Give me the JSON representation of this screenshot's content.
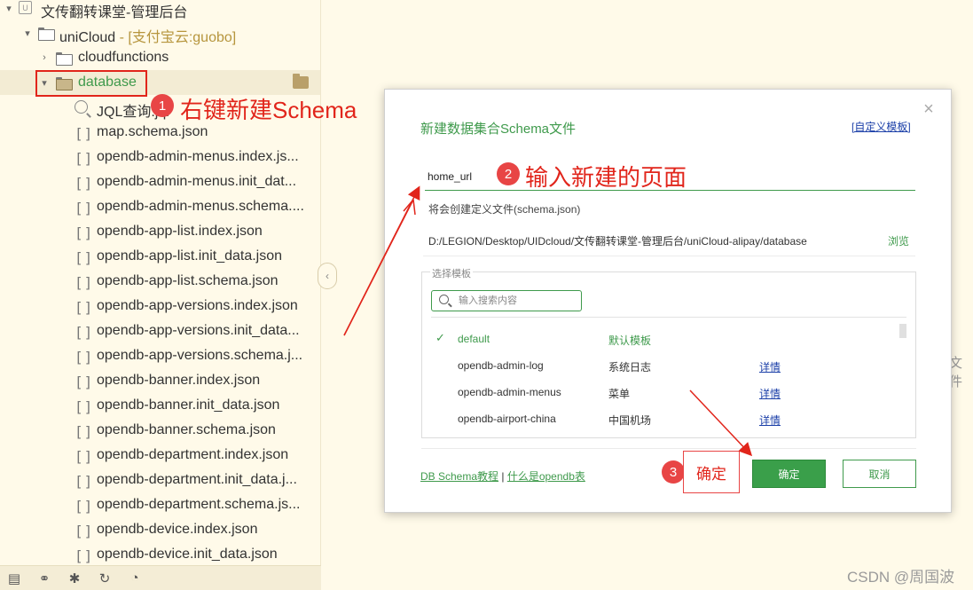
{
  "tree": {
    "project": {
      "name": "文传翻转课堂-管理后台"
    },
    "unicloud": {
      "name": "uniCloud",
      "suffix": " - [支付宝云:guobo]"
    },
    "cloudfunctions": {
      "name": "cloudfunctions"
    },
    "database": {
      "name": "database"
    },
    "files": [
      "JQL查询.jql",
      "map.schema.json",
      "opendb-admin-menus.index.js...",
      "opendb-admin-menus.init_dat...",
      "opendb-admin-menus.schema....",
      "opendb-app-list.index.json",
      "opendb-app-list.init_data.json",
      "opendb-app-list.schema.json",
      "opendb-app-versions.index.json",
      "opendb-app-versions.init_data...",
      "opendb-app-versions.schema.j...",
      "opendb-banner.index.json",
      "opendb-banner.init_data.json",
      "opendb-banner.schema.json",
      "opendb-department.index.json",
      "opendb-department.init_data.j...",
      "opendb-department.schema.js...",
      "opendb-device.index.json",
      "opendb-device.init_data.json"
    ]
  },
  "annotations": {
    "step1": {
      "num": "1",
      "text": "右键新建Schema"
    },
    "step2": {
      "num": "2",
      "text": "输入新建的页面"
    },
    "step3": {
      "num": "3",
      "text": "确定"
    }
  },
  "dialog": {
    "title": "新建数据集合Schema文件",
    "custom_template_link": "[自定义模板]",
    "close_icon": "×",
    "name_value": "home_url",
    "note": "将会创建定义文件(schema.json)",
    "path": "D:/LEGION/Desktop/UIDcloud/文传翻转课堂-管理后台/uniCloud-alipay/database",
    "browse_label": "浏览",
    "template_legend": "选择模板",
    "search_placeholder": "输入搜索内容",
    "templates": [
      {
        "name": "default",
        "desc": "默认模板",
        "detail": ""
      },
      {
        "name": "opendb-admin-log",
        "desc": "系统日志",
        "detail": "详情"
      },
      {
        "name": "opendb-admin-menus",
        "desc": "菜单",
        "detail": "详情"
      },
      {
        "name": "opendb-airport-china",
        "desc": "中国机场",
        "detail": "详情"
      }
    ],
    "link_schema_tutorial": "DB Schema教程",
    "link_separator": " | ",
    "link_what_is_opendb": "什么是opendb表",
    "ok_label": "确定",
    "cancel_label": "取消"
  },
  "background": {
    "right_hint": "文件",
    "watermark": "CSDN @周国波"
  },
  "colors": {
    "accent_green": "#3f9a4c",
    "annotation_red": "#e1251b",
    "sidebar_bg": "#fffae9"
  }
}
